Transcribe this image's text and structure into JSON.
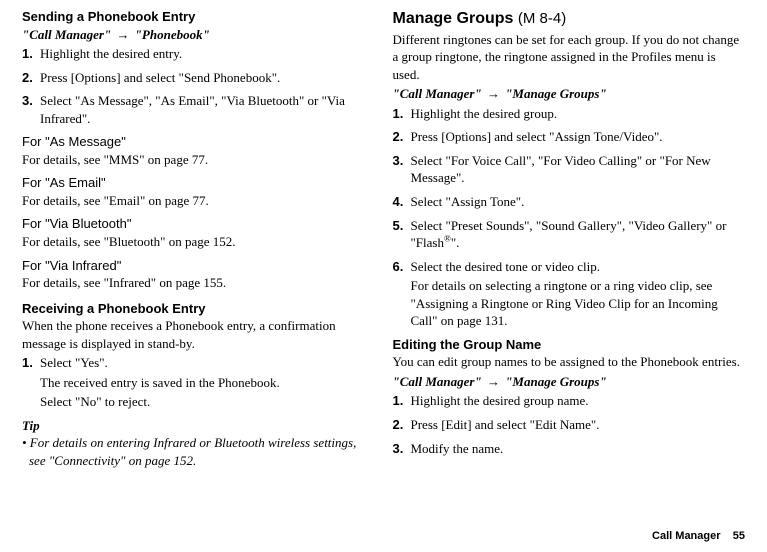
{
  "left": {
    "h_send": "Sending a Phonebook Entry",
    "nav_send": {
      "a": "\"Call Manager\"",
      "b": "\"Phonebook\""
    },
    "list_send": [
      "Highlight the desired entry.",
      "Press [Options] and select \"Send Phonebook\".",
      "Select \"As Message\", \"As Email\", \"Via Bluetooth\" or \"Via Infrared\"."
    ],
    "sub1_h": "For \"As Message\"",
    "sub1_t": "For details, see \"MMS\" on page 77.",
    "sub2_h": "For \"As Email\"",
    "sub2_t": "For details, see \"Email\" on page 77.",
    "sub3_h": "For \"Via Bluetooth\"",
    "sub3_t": "For details, see \"Bluetooth\" on page 152.",
    "sub4_h": "For \"Via Infrared\"",
    "sub4_t": "For details, see \"Infrared\" on page 155.",
    "h_recv": "Receiving a Phonebook Entry",
    "recv_body": "When the phone receives a Phonebook entry, a confirmation message is displayed in stand-by.",
    "list_recv": [
      "Select \"Yes\"."
    ],
    "recv_indent1": "The received entry is saved in the Phonebook.",
    "recv_indent2": "Select \"No\" to reject.",
    "tip_label": "Tip",
    "tip_text": "• For details on entering Infrared or Bluetooth wireless settings, see \"Connectivity\" on page 152."
  },
  "right": {
    "h_manage": "Manage Groups",
    "h_manage_code": "(M 8-4)",
    "manage_body": "Different ringtones can be set for each group. If you do not change a group ringtone, the ringtone assigned in the Profiles menu is used.",
    "nav_manage": {
      "a": "\"Call Manager\"",
      "b": "\"Manage Groups\""
    },
    "list_manage": [
      "Highlight the desired group.",
      "Press [Options] and select \"Assign Tone/Video\".",
      "Select \"For Voice Call\", \"For Video Calling\" or \"For New Message\".",
      "Select \"Assign Tone\".",
      {
        "pre": "Select \"Preset Sounds\", \"Sound Gallery\", \"Video Gallery\" or \"Flash",
        "sup": "®",
        "post": "\"."
      },
      "Select the desired tone or video clip."
    ],
    "manage_indent": "For details on selecting a ringtone or a ring video clip, see \"Assigning a Ringtone or Ring Video Clip for an Incoming Call\" on page 131.",
    "h_edit": "Editing the Group Name",
    "edit_body": "You can edit group names to be assigned to the Phonebook entries.",
    "nav_edit": {
      "a": "\"Call Manager\"",
      "b": "\"Manage Groups\""
    },
    "list_edit": [
      "Highlight the desired group name.",
      "Press [Edit] and select \"Edit Name\".",
      "Modify the name."
    ]
  },
  "footer": {
    "label": "Call Manager",
    "page": "55"
  }
}
